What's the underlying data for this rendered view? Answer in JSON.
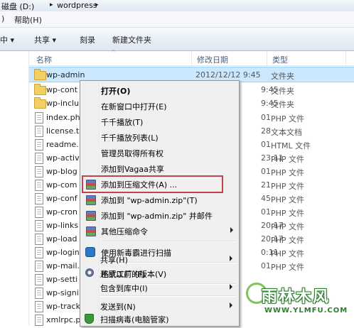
{
  "address": {
    "drive": "磁盘 (D:)",
    "folder": "wordpress",
    "sep": "▸"
  },
  "menubar": {
    "left_item": ")",
    "help": "帮助(H)"
  },
  "toolbar": {
    "left": "中 ▾",
    "share": "共享 ▾",
    "burn": "刻录",
    "new_folder": "新建文件夹"
  },
  "columns": {
    "name": "名称",
    "date": "修改日期",
    "type": "类型"
  },
  "files": [
    {
      "name": "wp-admin",
      "date": "2012/12/12 9:45",
      "type": "文件夹",
      "kind": "folder"
    },
    {
      "name": "wp-cont",
      "date": "9:45",
      "type": "文件夹",
      "kind": "folder"
    },
    {
      "name": "wp-inclu",
      "date": "9:45",
      "type": "文件夹",
      "kind": "folder"
    },
    {
      "name": "index.ph",
      "date": "01",
      "type": "PHP 文件",
      "kind": "doc"
    },
    {
      "name": "license.t",
      "date": "28",
      "type": "文本文档",
      "kind": "doc"
    },
    {
      "name": "readme.",
      "date": "01",
      "type": "HTML 文件",
      "kind": "doc"
    },
    {
      "name": "wp-activ",
      "date": "23:11",
      "type": "PHP 文件",
      "kind": "doc"
    },
    {
      "name": "wp-blog",
      "date": "01",
      "type": "PHP 文件",
      "kind": "doc"
    },
    {
      "name": "wp-com",
      "date": "21",
      "type": "PHP 文件",
      "kind": "doc"
    },
    {
      "name": "wp-conf",
      "date": "45",
      "type": "PHP 文件",
      "kind": "doc"
    },
    {
      "name": "wp-cron",
      "date": "01",
      "type": "PHP 文件",
      "kind": "doc"
    },
    {
      "name": "wp-links",
      "date": "20:17",
      "type": "PHP 文件",
      "kind": "doc"
    },
    {
      "name": "wp-load",
      "date": "20:17",
      "type": "PHP 文件",
      "kind": "doc"
    },
    {
      "name": "wp-login",
      "date": "0:11",
      "type": "PHP 文件",
      "kind": "doc"
    },
    {
      "name": "wp-mail.",
      "date": "01",
      "type": "PHP 文件",
      "kind": "doc"
    },
    {
      "name": "wp-setti",
      "date": "",
      "type": "",
      "kind": "doc"
    },
    {
      "name": "wp-signi",
      "date": "",
      "type": "",
      "kind": "doc"
    },
    {
      "name": "wp-track",
      "date": "",
      "type": "",
      "kind": "doc"
    },
    {
      "name": "xmlrpc.pi",
      "date": "",
      "type": "",
      "kind": "doc"
    }
  ],
  "context_menu": {
    "open": "打开(O)",
    "open_new_window": "在新窗口中打开(E)",
    "ttplayer_play": "千千播放(T)",
    "ttplayer_list": "千千播放列表(L)",
    "take_ownership": "管理员取得所有权",
    "add_vagaa": "添加到Vagaa共享",
    "add_archive": "添加到压缩文件(A) ...",
    "add_zip": "添加到 \"wp-admin.zip\"(T)",
    "add_zip_email": "添加到 \"wp-admin.zip\" 并邮件",
    "other_compress": "其他压缩命令",
    "scan_virus": "使用新毒霸进行扫描",
    "format_factory": "格式工厂 (F)",
    "share": "共享(H)",
    "restore": "还原以前的版本(V)",
    "include_library": "包含到库中(I)",
    "send_to": "发送到(N)",
    "scan_guard": "扫描病毒(电脑管家)"
  },
  "watermark": {
    "title": "雨林木风",
    "url": "WWW.YLMFU.COM"
  },
  "colors": {
    "highlight_border": "#c4424a",
    "selected_row": "#cce8ff"
  }
}
